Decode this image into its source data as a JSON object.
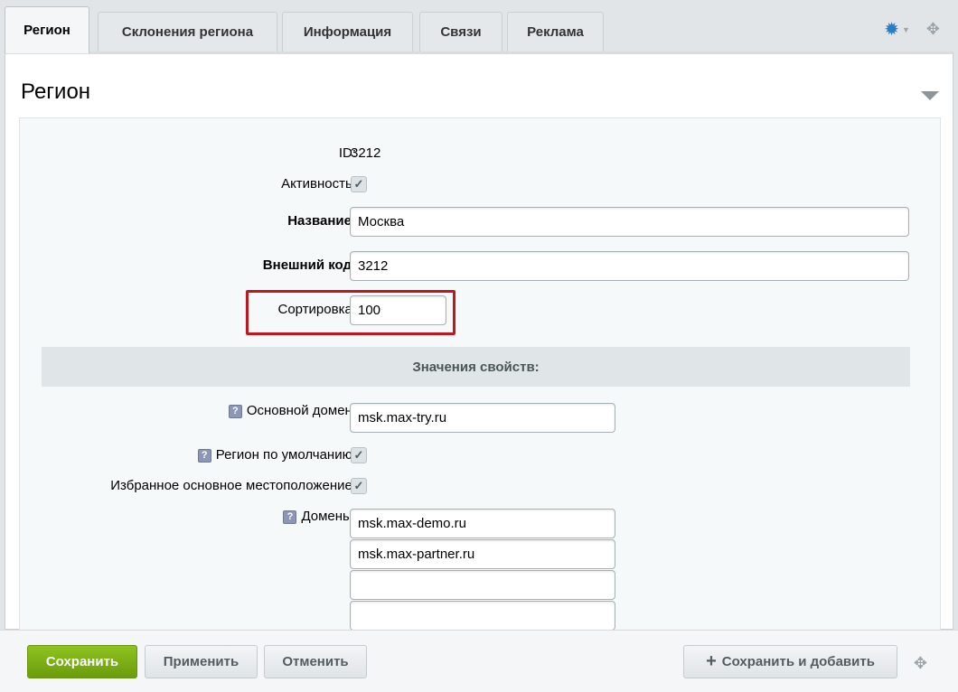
{
  "tabs": [
    {
      "label": "Регион",
      "active": true
    },
    {
      "label": "Склонения региона"
    },
    {
      "label": "Информация"
    },
    {
      "label": "Связи"
    },
    {
      "label": "Реклама"
    }
  ],
  "toolbar": {
    "settings_icon": "gear-icon",
    "pin_icon": "pin-icon"
  },
  "section": {
    "title": "Регион"
  },
  "fields": {
    "id": {
      "label": "ID:",
      "value": "3212"
    },
    "active": {
      "label": "Активность:",
      "checked": true
    },
    "name": {
      "label": "Название:",
      "value": "Москва"
    },
    "external_code": {
      "label": "Внешний код:",
      "value": "3212"
    },
    "sort": {
      "label": "Сортировка:",
      "value": "100"
    }
  },
  "properties": {
    "title": "Значения свойств:",
    "main_domain": {
      "label": "Основной домен:",
      "value": "msk.max-try.ru"
    },
    "default_region": {
      "label": "Регион по умолчанию:",
      "checked": true
    },
    "favorite_location": {
      "label": "Избранное основное местоположение:",
      "checked": true
    },
    "domains": {
      "label": "Домены:",
      "values": [
        "msk.max-demo.ru",
        "msk.max-partner.ru",
        "",
        ""
      ]
    }
  },
  "hint_glyph": "?",
  "footer": {
    "save": "Сохранить",
    "apply": "Применить",
    "cancel": "Отменить",
    "save_and_add": "Сохранить и добавить"
  },
  "colors": {
    "accent_green": "#7ab317",
    "highlight_red": "#c0161f",
    "gear_blue": "#2a7cc7"
  }
}
